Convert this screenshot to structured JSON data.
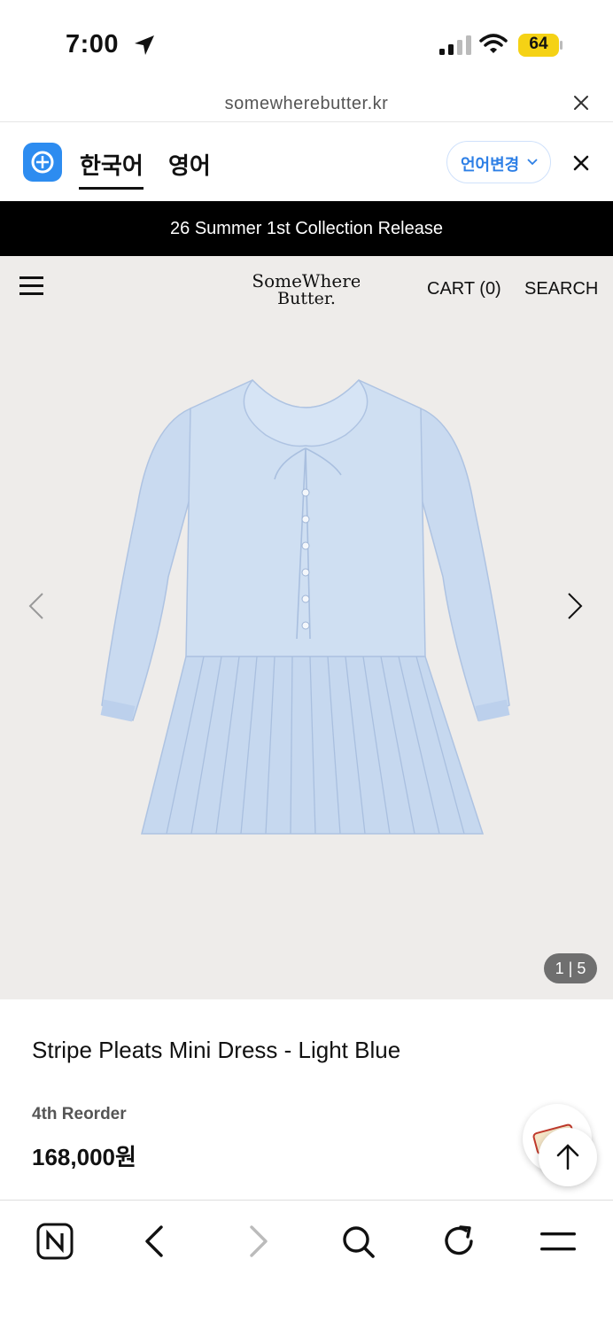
{
  "status_bar": {
    "time": "7:00",
    "battery": "64",
    "battery_color": "#f5d215"
  },
  "url_bar": {
    "domain": "somewherebutter.kr"
  },
  "translate_bar": {
    "tab_source": "한국어",
    "tab_target": "영어",
    "change_language": "언어변경"
  },
  "announcement": {
    "text": "26 Summer 1st Collection Release"
  },
  "site_header": {
    "brand_line1": "SomeWhere",
    "brand_line2": "Butter.",
    "cart": "CART (0)",
    "search": "SEARCH"
  },
  "gallery": {
    "pager": "1 | 5",
    "dress_color": "#c9daf0"
  },
  "product": {
    "name": "Stripe Pleats Mini Dress - Light Blue",
    "tag": "4th Reorder",
    "price": "168,000원"
  },
  "toolbar": {
    "items": [
      "naver-home",
      "back",
      "forward",
      "search",
      "reload",
      "menu"
    ]
  }
}
